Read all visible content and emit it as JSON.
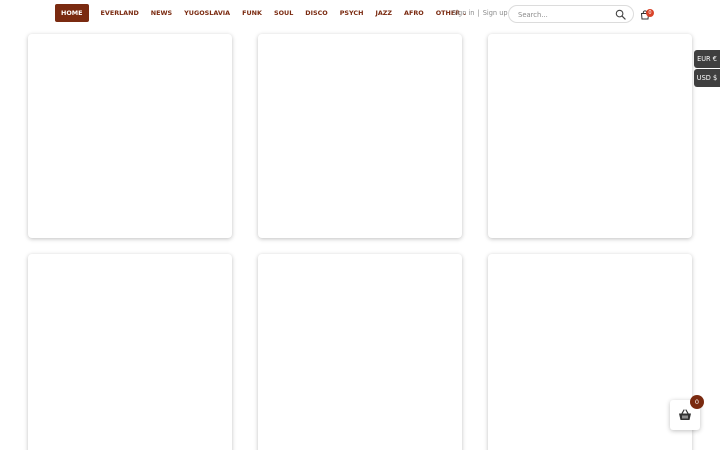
{
  "nav": {
    "items": [
      {
        "label": "HOME",
        "active": true
      },
      {
        "label": "EVERLAND"
      },
      {
        "label": "NEWS"
      },
      {
        "label": "YUGOSLAVIA"
      },
      {
        "label": "FUNK"
      },
      {
        "label": "SOUL"
      },
      {
        "label": "DISCO"
      },
      {
        "label": "PSYCH"
      },
      {
        "label": "JAZZ"
      },
      {
        "label": "AFRO"
      },
      {
        "label": "OTHER"
      }
    ]
  },
  "auth": {
    "sign_in": "Sign in",
    "separator": "|",
    "sign_up": "Sign up"
  },
  "search": {
    "placeholder": "Search...",
    "icon": "search-icon"
  },
  "cart": {
    "count": "0",
    "icon": "shopping-bag-icon"
  },
  "currency_switcher": [
    {
      "label": "EUR €"
    },
    {
      "label": "USD $"
    }
  ],
  "floating_cart": {
    "count": "0",
    "icon": "basket-icon"
  },
  "colors": {
    "accent": "#7a2a10",
    "badge_red": "#d9442a",
    "currency_bg": "#3f3f3f"
  },
  "products": [
    {},
    {},
    {},
    {},
    {},
    {}
  ]
}
